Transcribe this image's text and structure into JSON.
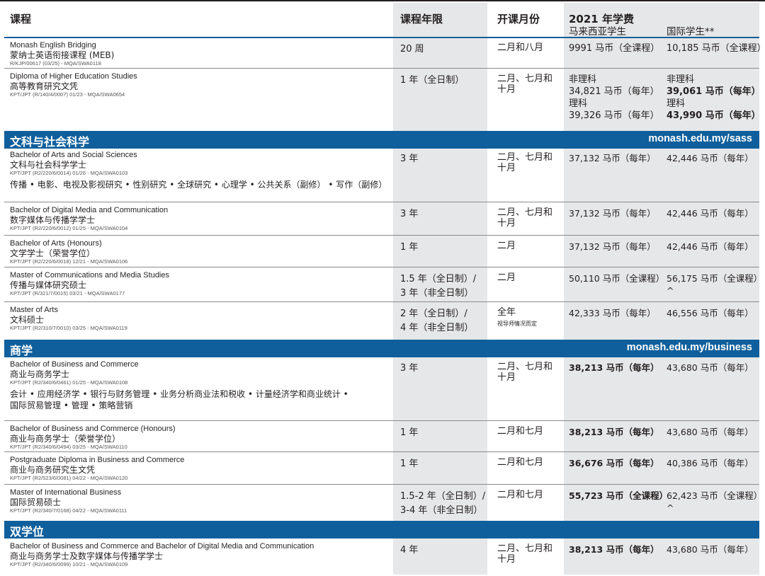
{
  "headers": {
    "course": "课程",
    "duration": "课程年限",
    "intake": "开课月份",
    "fee": "2021 年学费",
    "malaysian": "马来西亚学生",
    "international": "国际学生**"
  },
  "rows": [
    {
      "en": "Monash English Bridging",
      "zh": "蒙纳士英语衔接课程 (MEB)",
      "code": "R/KJP/00617 (03/25) - MQA/SWA0118",
      "duration": "20 周",
      "intake": "二月和八月",
      "fee_my": "9991 马币（全课程）",
      "fee_intl": "10,185 马币（全课程）"
    },
    {
      "en": "Diploma of Higher Education Studies",
      "zh": "高等教育研究文凭",
      "code": "KPT/JPT (R/140/4/0007) 01/23 - MQA/SWA0654",
      "duration": "1 年（全日制）",
      "intake": "二月、七月和\n十月",
      "fee_my_lines": [
        "非理科",
        "34,821 马币（每年）",
        "理科",
        "39,326 马币（每年）"
      ],
      "fee_intl_lines": [
        "非理科",
        "39,061 马币（每年）",
        "理科",
        "43,990 马币（每年）"
      ]
    },
    {
      "en": "Bachelor of Arts and Social Sciences",
      "zh": "文科与社会科学学士",
      "code": "KPT/JPT (R2/220/6/0014) 01/26 - MQA/SWA0103",
      "majors": "传播 • 电影、电视及影视研究 • 性别研究 • 全球研究 • 心理学 • 公共关系（副修） • 写作（副修）",
      "duration": "3 年",
      "intake": "二月、七月和\n十月",
      "fee_my": "37,132 马币（每年）",
      "fee_intl": "42,446 马币（每年）"
    },
    {
      "en": "Bachelor of Digital Media and Communication",
      "zh": "数字媒体与传播学学士",
      "code": "KPT/JPT (R2/220/6/0012) 01/25 - MQA/SWA0104",
      "duration": "3 年",
      "intake": "二月、七月和\n十月",
      "fee_my": "37,132 马币（每年）",
      "fee_intl": "42,446 马币（每年）"
    },
    {
      "en": "Bachelor of Arts (Honours)",
      "zh": "文学学士（荣誉学位）",
      "code": "KPT/JPT (R2/220/6/0018) 12/21 - MQA/SWA0106",
      "duration": "1 年",
      "intake": "二月",
      "fee_my": "37,132 马币（每年）",
      "fee_intl": "42,446 马币（每年）"
    },
    {
      "en": "Master of Communications and Media Studies",
      "zh": "传播与媒体研究硕士",
      "code": "KPT/JPT (R/321/7/0015) 03/21 - MQA/SWA0177",
      "duration": "1.5 年（全日制）/\n3 年（非全日制）",
      "intake": "二月",
      "fee_my": "50,110 马币（全课程）",
      "fee_intl": "56,175 马币（全课程）^"
    },
    {
      "en": "Master of Arts",
      "zh": "文科硕士",
      "code": "KPT/JPT (R2/310/7/0010) 03/25 - MQA/SWA0119",
      "duration": "2 年（全日制）/\n4 年（非全日制）",
      "intake": "全年",
      "intake_note": "视导师情况而定",
      "fee_my": "42,333 马币（每年）",
      "fee_intl": "46,556 马币（每年）"
    },
    {
      "en": "Bachelor of Business and Commerce",
      "zh": "商业与商务学士",
      "code": "KPT/JPT (R2/340/6/0461) 01/25 - MQA/SWA0108",
      "majors": "会计 • 应用经济学 • 银行与财务管理 • 业务分析商业法和税收 • 计量经济学和商业统计 •\n国际贸易管理 • 管理 • 策略营销",
      "duration": "3 年",
      "intake": "二月、七月和\n十月",
      "fee_my": "38,213 马币（每年）",
      "fee_intl": "43,680 马币（每年）"
    },
    {
      "en": "Bachelor of Business and Commerce (Honours)",
      "zh": "商业与商务学士（荣誉学位）",
      "code": "KPT/JPT (R2/340/6/0494) 03/25 - MQA/SWA0110",
      "duration": "1 年",
      "intake": "二月和七月",
      "fee_my": "38,213 马币（每年）",
      "fee_intl": "43,680 马币（每年）"
    },
    {
      "en": "Postgraduate Diploma in Business and Commerce",
      "zh": "商业与商务研究生文凭",
      "code": "KPT/JPT (R2/523/6/0081) 04/22 - MQA/SWA0120",
      "duration": "1 年",
      "intake": "二月和七月",
      "fee_my": "36,676 马币（每年）",
      "fee_intl": "40,386 马币（每年）"
    },
    {
      "en": "Master of International Business",
      "zh": "国际贸易硕士",
      "code": "KPT/JPT (R2/340/7/0168) 04/22 - MQA/SWA0111",
      "duration": "1.5-2 年（全日制）/\n3-4 年（非全日制）",
      "intake": "二月和七月",
      "fee_my": "55,723 马币（全课程）",
      "fee_intl": "62,423 马币（全课程）^"
    },
    {
      "en": "Bachelor of Business and Commerce and Bachelor of Digital Media and Communication",
      "zh": "商业与商务学士及数字媒体与传播学学士",
      "code": "KPT/JPT (R2/340/6/0099) 10/21 - MQA/SWA0109",
      "duration": "4 年",
      "intake": "二月、七月和\n十月",
      "fee_my": "38,213 马币（每年）",
      "fee_intl": "43,680 马币（每年）"
    }
  ],
  "sections": [
    {
      "title": "文科与社会科学",
      "url": "monash.edu.my/sass"
    },
    {
      "title": "商学",
      "url": "monash.edu.my/business"
    },
    {
      "title": "双学位",
      "url": ""
    }
  ]
}
